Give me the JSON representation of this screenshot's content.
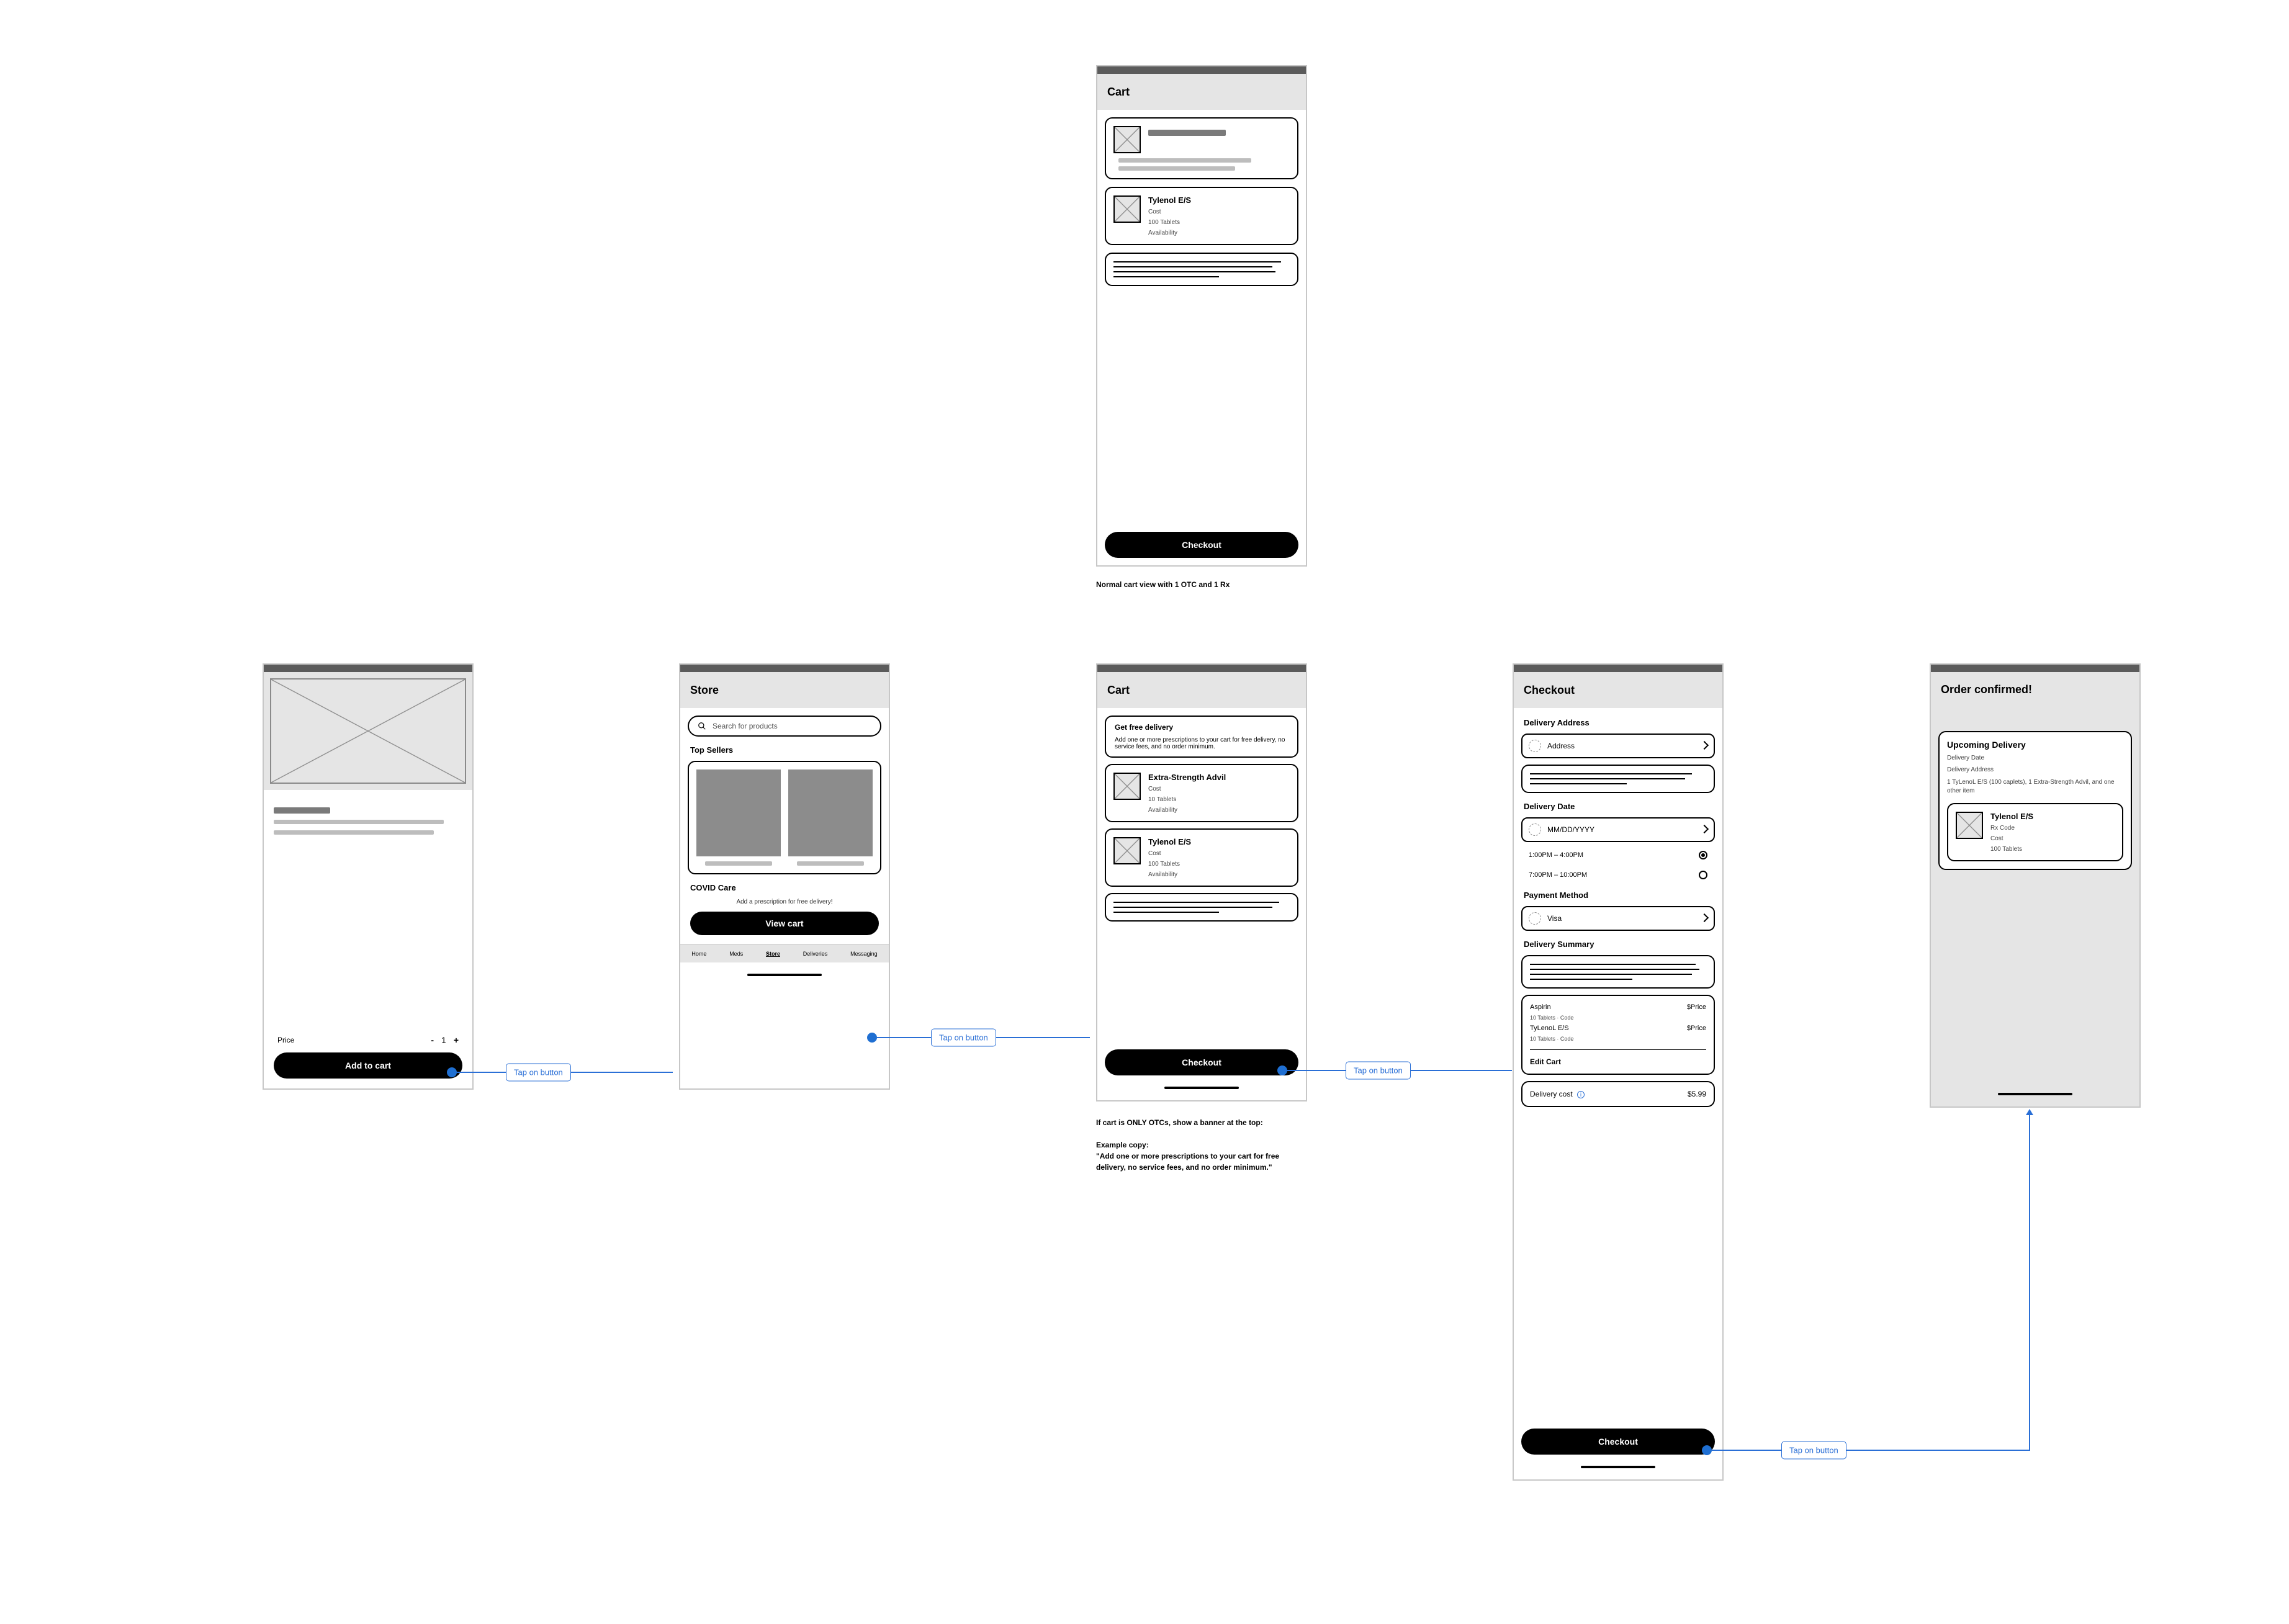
{
  "flow_label": "Tap on button",
  "notes": {
    "cart_top_caption": "Normal cart view with 1 OTC and 1 Rx",
    "cart_otc_caption_line1": "If cart is ONLY OTCs, show a banner at the top:",
    "cart_otc_caption_line2": "Example copy:",
    "cart_otc_caption_line3": "\"Add one or more prescriptions to your cart for free delivery, no service fees, and no order minimum.\""
  },
  "screens": {
    "product": {
      "price_label": "Price",
      "qty": "1",
      "add_to_cart": "Add to cart"
    },
    "store": {
      "title": "Store",
      "search_placeholder": "Search for products",
      "top_sellers_label": "Top Sellers",
      "covid_label": "COVID Care",
      "rx_note": "Add a prescription for free delivery!",
      "view_cart": "View cart",
      "tabs": [
        "Home",
        "Meds",
        "Store",
        "Deliveries",
        "Messaging"
      ]
    },
    "cart_top": {
      "title": "Cart",
      "item": {
        "name": "Tylenol E/S",
        "cost": "Cost",
        "qty": "100 Tablets",
        "avail": "Availability"
      },
      "checkout": "Checkout"
    },
    "cart_main": {
      "title": "Cart",
      "banner_title": "Get free delivery",
      "banner_sub": "Add one or more prescriptions to your cart for free delivery, no service fees, and no order minimum.",
      "item1": {
        "name": "Extra-Strength Advil",
        "cost": "Cost",
        "qty": "10 Tablets",
        "avail": "Availability"
      },
      "item2": {
        "name": "Tylenol E/S",
        "cost": "Cost",
        "qty": "100 Tablets",
        "avail": "Availability"
      },
      "checkout": "Checkout"
    },
    "checkout": {
      "title": "Checkout",
      "address_label": "Delivery Address",
      "address_field": "Address",
      "date_label": "Delivery Date",
      "date_field": "MM/DD/YYYY",
      "slot1": "1:00PM – 4:00PM",
      "slot2": "7:00PM – 10:00PM",
      "payment_label": "Payment Method",
      "payment_field": "Visa",
      "summary_label": "Delivery Summary",
      "line_items": [
        {
          "name": "Aspirin",
          "sub": "10 Tablets · Code",
          "price": "$Price"
        },
        {
          "name": "TyLenoL E/S",
          "sub": "10 Tablets · Code",
          "price": "$Price"
        }
      ],
      "edit_cart": "Edit Cart",
      "delivery_cost_label": "Delivery cost",
      "delivery_cost_info": "ⓘ",
      "delivery_cost_value": "$5.99",
      "checkout_btn": "Checkout"
    },
    "confirm": {
      "title": "Order confirmed!",
      "upcoming": "Upcoming Delivery",
      "date": "Delivery Date",
      "addr": "Delivery Address",
      "summary_line": "1 TyLenoL E/S (100 caplets), 1 Extra-Strength Advil, and one other item",
      "rx": {
        "name": "Tylenol E/S",
        "code": "Rx Code",
        "cost": "Cost",
        "qty": "100 Tablets"
      }
    }
  }
}
